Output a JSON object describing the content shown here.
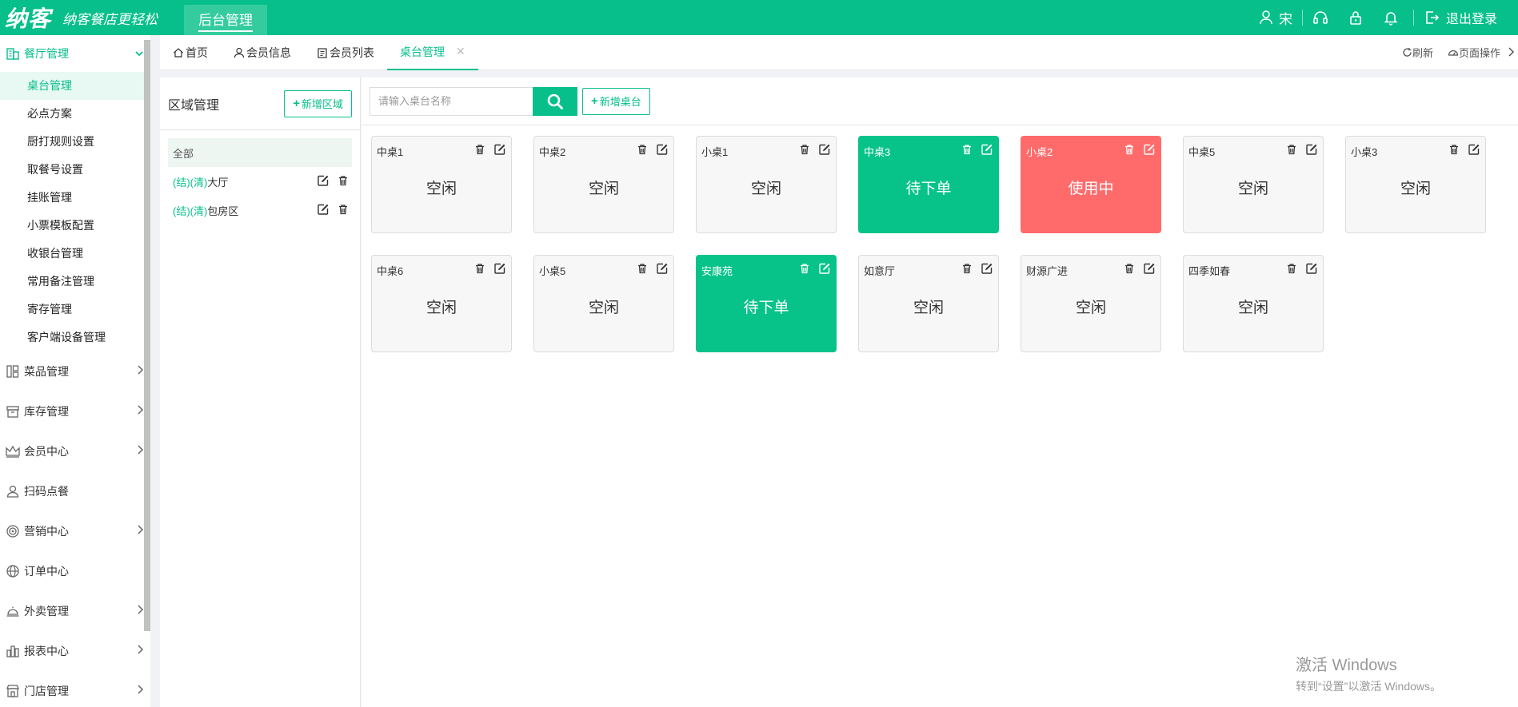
{
  "header": {
    "logo": "纳客",
    "slogan": "纳客餐店更轻松",
    "top_tab": "后台管理",
    "user_name": "宋",
    "logout": "退出登录"
  },
  "sidebar": {
    "open_group": "餐厅管理",
    "sub_items": [
      "桌台管理",
      "必点方案",
      "厨打规则设置",
      "取餐号设置",
      "挂账管理",
      "小票模板配置",
      "收银台管理",
      "常用备注管理",
      "寄存管理",
      "客户端设备管理"
    ],
    "active_sub": "桌台管理",
    "groups": [
      {
        "label": "菜品管理",
        "icon": "menu-grid-icon",
        "arrow": true
      },
      {
        "label": "库存管理",
        "icon": "box-icon",
        "arrow": true
      },
      {
        "label": "会员中心",
        "icon": "crown-icon",
        "arrow": true
      },
      {
        "label": "扫码点餐",
        "icon": "person-icon",
        "arrow": false
      },
      {
        "label": "营销中心",
        "icon": "target-icon",
        "arrow": true
      },
      {
        "label": "订单中心",
        "icon": "globe-icon",
        "arrow": false
      },
      {
        "label": "外卖管理",
        "icon": "cloche-icon",
        "arrow": true
      },
      {
        "label": "报表中心",
        "icon": "chart-icon",
        "arrow": true
      },
      {
        "label": "门店管理",
        "icon": "store-icon",
        "arrow": true
      }
    ]
  },
  "tabs": {
    "items": [
      {
        "label": "首页",
        "icon": "home-icon"
      },
      {
        "label": "会员信息",
        "icon": "user-icon"
      },
      {
        "label": "会员列表",
        "icon": "clipboard-icon"
      },
      {
        "label": "桌台管理",
        "icon": ""
      }
    ],
    "refresh": "刷新",
    "page_ops": "页面操作"
  },
  "region": {
    "title": "区域管理",
    "add_button": "新增区域",
    "items": [
      {
        "label": "全部",
        "tag": ""
      },
      {
        "label": "大厅",
        "tag": "(结)(清)"
      },
      {
        "label": "包房区",
        "tag": "(结)(清)"
      }
    ]
  },
  "toolbar": {
    "search_placeholder": "请输入桌台名称",
    "add_table": "新增桌台"
  },
  "tables": [
    {
      "name": "中桌1",
      "status": "空闲",
      "state": "idle"
    },
    {
      "name": "中桌2",
      "status": "空闲",
      "state": "idle"
    },
    {
      "name": "小桌1",
      "status": "空闲",
      "state": "idle"
    },
    {
      "name": "中桌3",
      "status": "待下单",
      "state": "pending"
    },
    {
      "name": "小桌2",
      "status": "使用中",
      "state": "inuse"
    },
    {
      "name": "中桌5",
      "status": "空闲",
      "state": "idle"
    },
    {
      "name": "小桌3",
      "status": "空闲",
      "state": "idle"
    },
    {
      "name": "中桌6",
      "status": "空闲",
      "state": "idle"
    },
    {
      "name": "小桌5",
      "status": "空闲",
      "state": "idle"
    },
    {
      "name": "安康苑",
      "status": "待下单",
      "state": "pending"
    },
    {
      "name": "如意厅",
      "status": "空闲",
      "state": "idle"
    },
    {
      "name": "财源广进",
      "status": "空闲",
      "state": "idle"
    },
    {
      "name": "四季如春",
      "status": "空闲",
      "state": "idle"
    }
  ],
  "colors": {
    "brand": "#07bf8b",
    "pending": "#07c389",
    "inuse": "#ff6b6b"
  },
  "watermark": {
    "line1": "激活 Windows",
    "line2": "转到“设置”以激活 Windows。"
  }
}
